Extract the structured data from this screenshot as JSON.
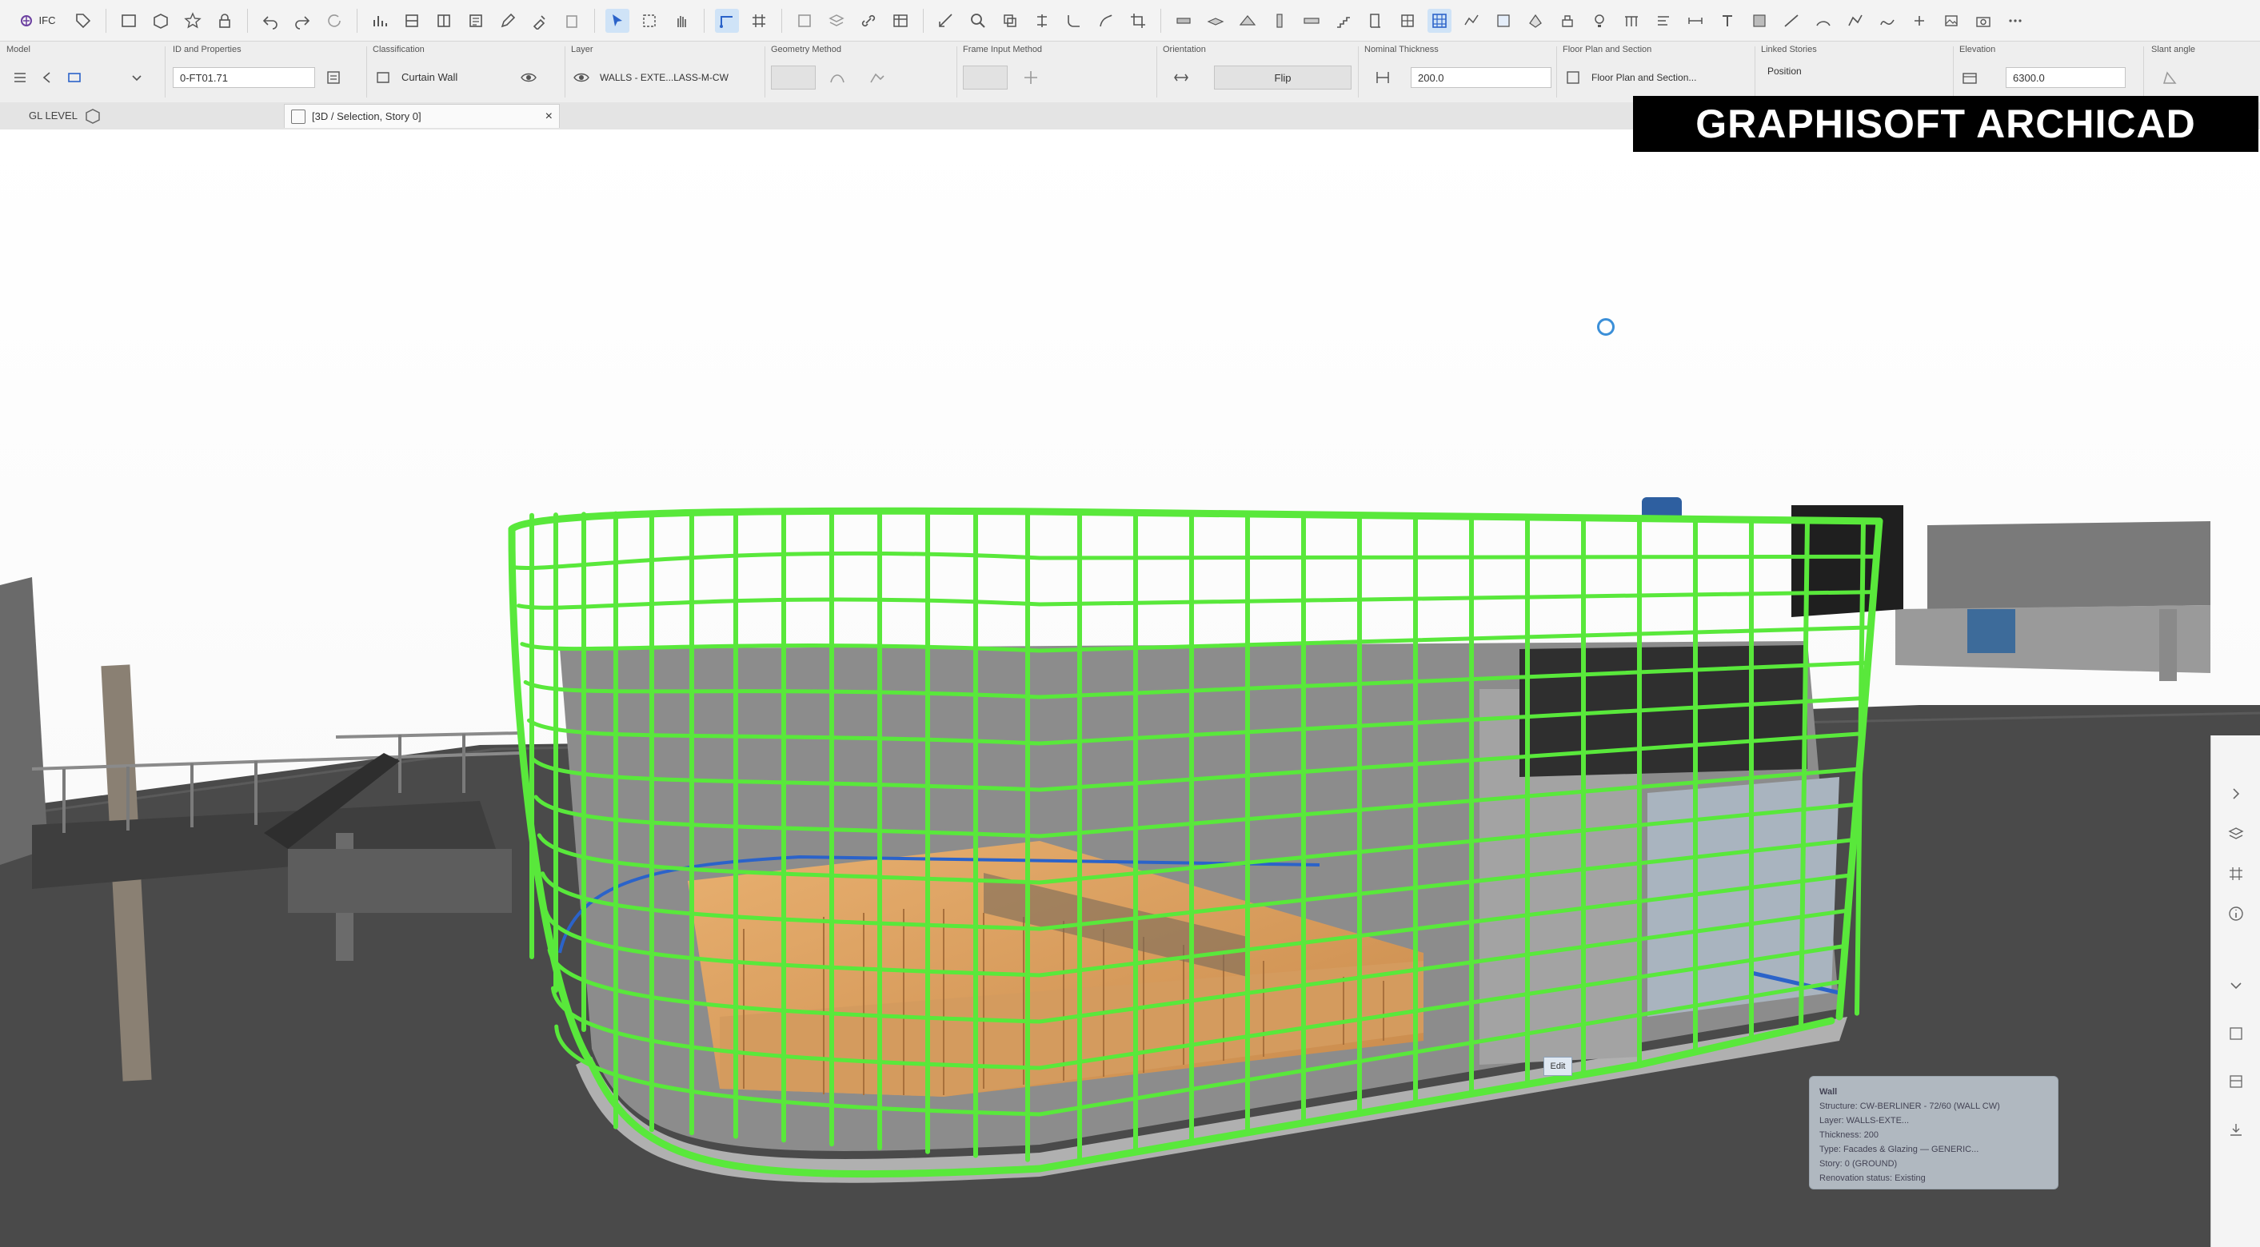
{
  "colors": {
    "selection": "#59e83b",
    "ground": "#4a4a4a",
    "floor_wood": "#e0a060",
    "brand_bg": "#000000",
    "brand_fg": "#ffffff",
    "accent_blue": "#2b63c9"
  },
  "toolbar": {
    "ifc_label": "IFC"
  },
  "infobox": {
    "id_properties": {
      "label": "ID and Properties",
      "value": "0-FT01.71"
    },
    "classification": {
      "label": "Classification",
      "value": "Curtain Wall"
    },
    "layer": {
      "label": "Layer",
      "value": "WALLS - EXTE...LASS-M-CW"
    },
    "geometry_method": {
      "label": "Geometry Method"
    },
    "frame_input_method": {
      "label": "Frame Input Method"
    },
    "orientation": {
      "label": "Orientation",
      "button": "Flip"
    },
    "nominal_thickness": {
      "label": "Nominal Thickness",
      "value": "200.0"
    },
    "floor_plan_section": {
      "label": "Floor Plan and Section",
      "value": "Floor Plan and Section..."
    },
    "linked_stories": {
      "label": "Linked Stories",
      "value": "Position"
    },
    "elevation": {
      "label": "Elevation",
      "value": "6300.0"
    },
    "slant_angle": {
      "label": "Slant angle"
    },
    "header_left": "Model"
  },
  "tabs": {
    "left_tab": "GL LEVEL",
    "active_tab": "[3D / Selection, Story 0]",
    "close_symbol": "×"
  },
  "brand": {
    "text": "GRAPHISOFT ARCHICAD"
  },
  "marker": {
    "text": "Edit"
  },
  "tooltip": {
    "lines": [
      "Wall",
      "Structure: CW-BERLINER - 72/60 (WALL CW)",
      "Layer: WALLS-EXTE...",
      "Thickness: 200",
      "Type: Facades & Glazing — GENERIC...",
      "Story: 0 (GROUND)",
      "Renovation status: Existing"
    ]
  },
  "icons": [
    "ifc-icon",
    "tag-icon",
    "undo-icon",
    "redo-icon",
    "arrow-icon",
    "marquee-icon",
    "grid-icon",
    "magnify-icon",
    "wall-icon",
    "slab-icon",
    "roof-icon",
    "column-icon",
    "beam-icon",
    "stair-icon",
    "door-icon",
    "window-icon",
    "curtain-wall-icon",
    "mesh-icon",
    "zone-icon",
    "morph-icon"
  ]
}
